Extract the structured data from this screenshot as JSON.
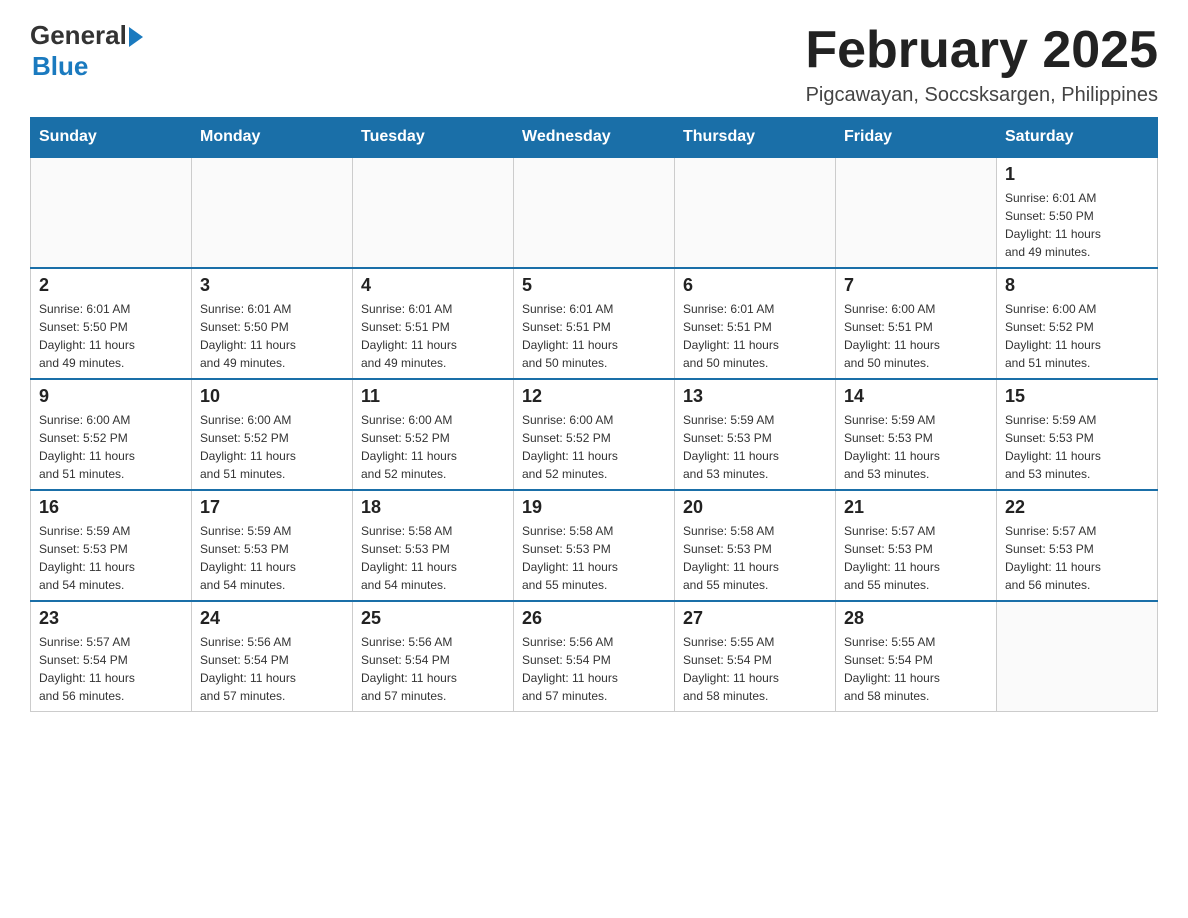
{
  "logo": {
    "general": "General",
    "blue": "Blue"
  },
  "title": {
    "month": "February 2025",
    "location": "Pigcawayan, Soccsksargen, Philippines"
  },
  "weekdays": [
    "Sunday",
    "Monday",
    "Tuesday",
    "Wednesday",
    "Thursday",
    "Friday",
    "Saturday"
  ],
  "weeks": [
    [
      {
        "day": "",
        "info": ""
      },
      {
        "day": "",
        "info": ""
      },
      {
        "day": "",
        "info": ""
      },
      {
        "day": "",
        "info": ""
      },
      {
        "day": "",
        "info": ""
      },
      {
        "day": "",
        "info": ""
      },
      {
        "day": "1",
        "info": "Sunrise: 6:01 AM\nSunset: 5:50 PM\nDaylight: 11 hours\nand 49 minutes."
      }
    ],
    [
      {
        "day": "2",
        "info": "Sunrise: 6:01 AM\nSunset: 5:50 PM\nDaylight: 11 hours\nand 49 minutes."
      },
      {
        "day": "3",
        "info": "Sunrise: 6:01 AM\nSunset: 5:50 PM\nDaylight: 11 hours\nand 49 minutes."
      },
      {
        "day": "4",
        "info": "Sunrise: 6:01 AM\nSunset: 5:51 PM\nDaylight: 11 hours\nand 49 minutes."
      },
      {
        "day": "5",
        "info": "Sunrise: 6:01 AM\nSunset: 5:51 PM\nDaylight: 11 hours\nand 50 minutes."
      },
      {
        "day": "6",
        "info": "Sunrise: 6:01 AM\nSunset: 5:51 PM\nDaylight: 11 hours\nand 50 minutes."
      },
      {
        "day": "7",
        "info": "Sunrise: 6:00 AM\nSunset: 5:51 PM\nDaylight: 11 hours\nand 50 minutes."
      },
      {
        "day": "8",
        "info": "Sunrise: 6:00 AM\nSunset: 5:52 PM\nDaylight: 11 hours\nand 51 minutes."
      }
    ],
    [
      {
        "day": "9",
        "info": "Sunrise: 6:00 AM\nSunset: 5:52 PM\nDaylight: 11 hours\nand 51 minutes."
      },
      {
        "day": "10",
        "info": "Sunrise: 6:00 AM\nSunset: 5:52 PM\nDaylight: 11 hours\nand 51 minutes."
      },
      {
        "day": "11",
        "info": "Sunrise: 6:00 AM\nSunset: 5:52 PM\nDaylight: 11 hours\nand 52 minutes."
      },
      {
        "day": "12",
        "info": "Sunrise: 6:00 AM\nSunset: 5:52 PM\nDaylight: 11 hours\nand 52 minutes."
      },
      {
        "day": "13",
        "info": "Sunrise: 5:59 AM\nSunset: 5:53 PM\nDaylight: 11 hours\nand 53 minutes."
      },
      {
        "day": "14",
        "info": "Sunrise: 5:59 AM\nSunset: 5:53 PM\nDaylight: 11 hours\nand 53 minutes."
      },
      {
        "day": "15",
        "info": "Sunrise: 5:59 AM\nSunset: 5:53 PM\nDaylight: 11 hours\nand 53 minutes."
      }
    ],
    [
      {
        "day": "16",
        "info": "Sunrise: 5:59 AM\nSunset: 5:53 PM\nDaylight: 11 hours\nand 54 minutes."
      },
      {
        "day": "17",
        "info": "Sunrise: 5:59 AM\nSunset: 5:53 PM\nDaylight: 11 hours\nand 54 minutes."
      },
      {
        "day": "18",
        "info": "Sunrise: 5:58 AM\nSunset: 5:53 PM\nDaylight: 11 hours\nand 54 minutes."
      },
      {
        "day": "19",
        "info": "Sunrise: 5:58 AM\nSunset: 5:53 PM\nDaylight: 11 hours\nand 55 minutes."
      },
      {
        "day": "20",
        "info": "Sunrise: 5:58 AM\nSunset: 5:53 PM\nDaylight: 11 hours\nand 55 minutes."
      },
      {
        "day": "21",
        "info": "Sunrise: 5:57 AM\nSunset: 5:53 PM\nDaylight: 11 hours\nand 55 minutes."
      },
      {
        "day": "22",
        "info": "Sunrise: 5:57 AM\nSunset: 5:53 PM\nDaylight: 11 hours\nand 56 minutes."
      }
    ],
    [
      {
        "day": "23",
        "info": "Sunrise: 5:57 AM\nSunset: 5:54 PM\nDaylight: 11 hours\nand 56 minutes."
      },
      {
        "day": "24",
        "info": "Sunrise: 5:56 AM\nSunset: 5:54 PM\nDaylight: 11 hours\nand 57 minutes."
      },
      {
        "day": "25",
        "info": "Sunrise: 5:56 AM\nSunset: 5:54 PM\nDaylight: 11 hours\nand 57 minutes."
      },
      {
        "day": "26",
        "info": "Sunrise: 5:56 AM\nSunset: 5:54 PM\nDaylight: 11 hours\nand 57 minutes."
      },
      {
        "day": "27",
        "info": "Sunrise: 5:55 AM\nSunset: 5:54 PM\nDaylight: 11 hours\nand 58 minutes."
      },
      {
        "day": "28",
        "info": "Sunrise: 5:55 AM\nSunset: 5:54 PM\nDaylight: 11 hours\nand 58 minutes."
      },
      {
        "day": "",
        "info": ""
      }
    ]
  ]
}
